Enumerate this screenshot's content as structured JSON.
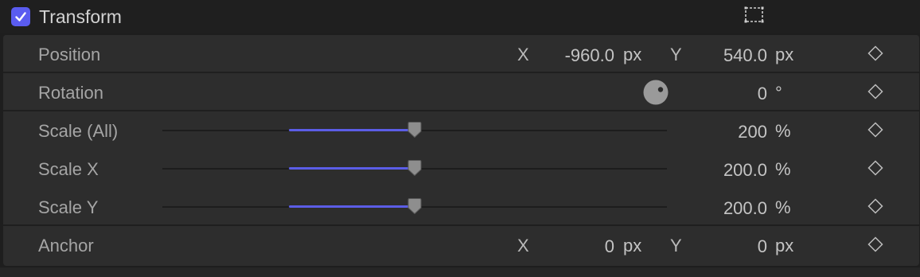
{
  "header": {
    "checked": true,
    "title": "Transform",
    "frame_icon": "transform-overlay-icon"
  },
  "rows": {
    "position": {
      "label": "Position",
      "x_axis": "X",
      "x_value": "-960.0",
      "x_unit": "px",
      "y_axis": "Y",
      "y_value": "540.0",
      "y_unit": "px"
    },
    "rotation": {
      "label": "Rotation",
      "value": "0",
      "unit": "°",
      "dial_icon": "rotation-dial-icon"
    },
    "scale_all": {
      "label": "Scale (All)",
      "value": "200",
      "unit": "%",
      "slider_fraction": 0.5
    },
    "scale_x": {
      "label": "Scale X",
      "value": "200.0",
      "unit": "%",
      "slider_fraction": 0.5
    },
    "scale_y": {
      "label": "Scale Y",
      "value": "200.0",
      "unit": "%",
      "slider_fraction": 0.5
    },
    "anchor": {
      "label": "Anchor",
      "x_axis": "X",
      "x_value": "0",
      "x_unit": "px",
      "y_axis": "Y",
      "y_value": "0",
      "y_unit": "px"
    }
  },
  "colors": {
    "accent": "#5a5cf0",
    "background": "#2d2d2d",
    "header": "#1f1f1f"
  },
  "icons": {
    "keyframe": "keyframe-diamond-icon",
    "checkbox": "checkmark-icon"
  }
}
